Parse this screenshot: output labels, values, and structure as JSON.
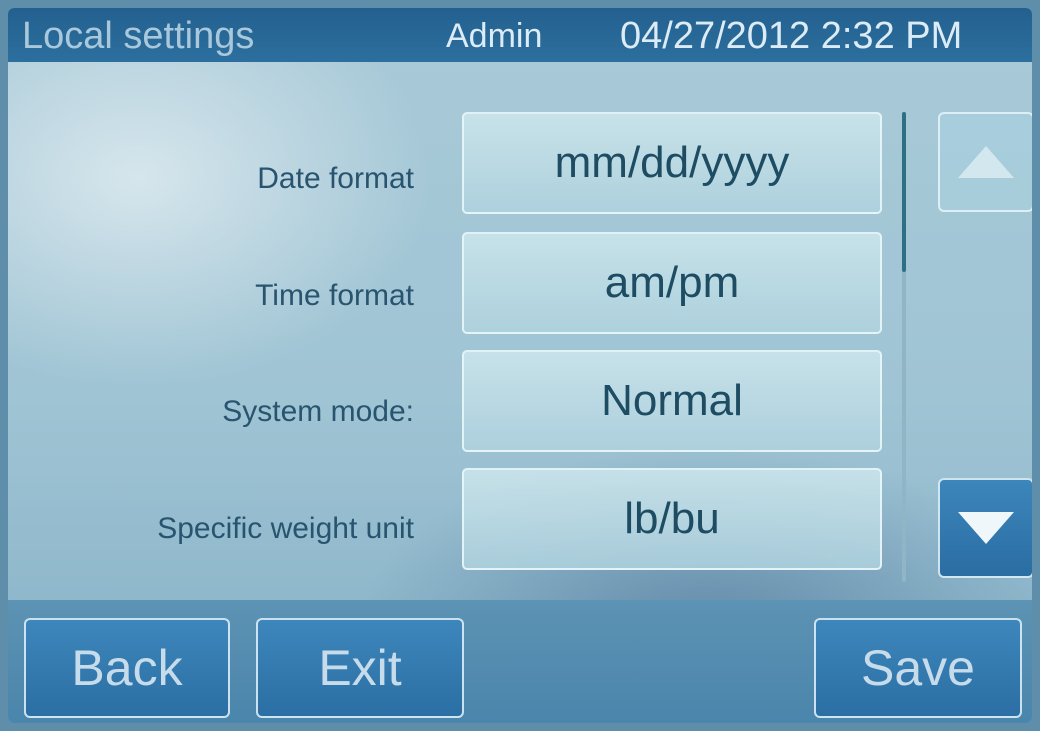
{
  "header": {
    "title": "Local settings",
    "user": "Admin",
    "datetime": "04/27/2012 2:32 PM"
  },
  "settings": [
    {
      "label": "Date format",
      "value": "mm/dd/yyyy"
    },
    {
      "label": "Time format",
      "value": "am/pm"
    },
    {
      "label": "System mode:",
      "value": "Normal"
    },
    {
      "label": "Specific weight unit",
      "value": "lb/bu"
    }
  ],
  "scroll": {
    "position_fraction": 0.0
  },
  "icons": {
    "up": "triangle-up-icon",
    "down": "triangle-down-icon"
  },
  "footer": {
    "back_label": "Back",
    "exit_label": "Exit",
    "save_label": "Save"
  },
  "colors": {
    "accent": "#2b6fa4",
    "header": "#23608f",
    "text": "#1d4c63"
  }
}
